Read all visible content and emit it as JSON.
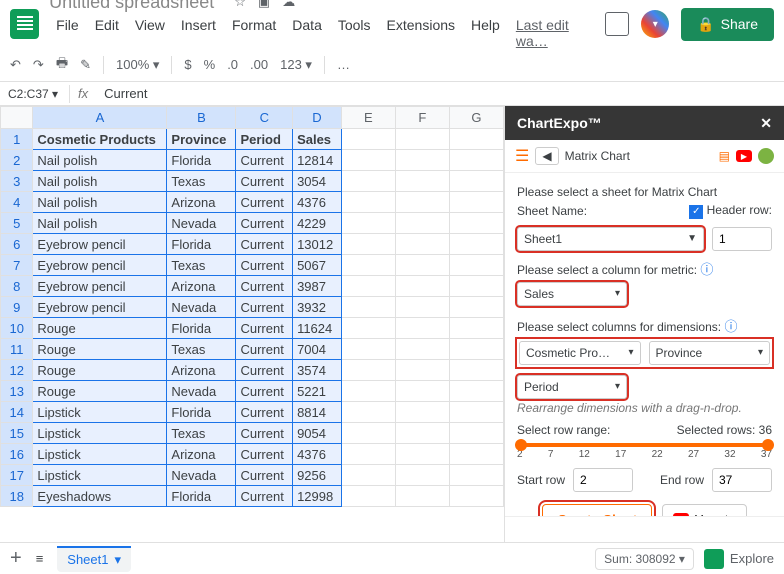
{
  "doc": {
    "title": "Untitled spreadsheet"
  },
  "menu": {
    "file": "File",
    "edit": "Edit",
    "view": "View",
    "insert": "Insert",
    "format": "Format",
    "data": "Data",
    "tools": "Tools",
    "extensions": "Extensions",
    "help": "Help",
    "last_edit": "Last edit wa…"
  },
  "share": "Share",
  "toolbar": {
    "zoom": "100%",
    "currency": "$",
    "percent": "%",
    "dec0": ".0",
    "dec00": ".00",
    "numfmt": "123",
    "font_more": "…"
  },
  "formula": {
    "cell": "C2:C37",
    "value": "Current"
  },
  "columns": [
    "A",
    "B",
    "C",
    "D",
    "E",
    "F",
    "G"
  ],
  "table": {
    "header": [
      "Cosmetic Products",
      "Province",
      "Period",
      "Sales"
    ],
    "rows": [
      [
        "Nail polish",
        "Florida",
        "Current",
        "12814"
      ],
      [
        "Nail polish",
        "Texas",
        "Current",
        "3054"
      ],
      [
        "Nail polish",
        "Arizona",
        "Current",
        "4376"
      ],
      [
        "Nail polish",
        "Nevada",
        "Current",
        "4229"
      ],
      [
        "Eyebrow pencil",
        "Florida",
        "Current",
        "13012"
      ],
      [
        "Eyebrow pencil",
        "Texas",
        "Current",
        "5067"
      ],
      [
        "Eyebrow pencil",
        "Arizona",
        "Current",
        "3987"
      ],
      [
        "Eyebrow pencil",
        "Nevada",
        "Current",
        "3932"
      ],
      [
        "Rouge",
        "Florida",
        "Current",
        "11624"
      ],
      [
        "Rouge",
        "Texas",
        "Current",
        "7004"
      ],
      [
        "Rouge",
        "Arizona",
        "Current",
        "3574"
      ],
      [
        "Rouge",
        "Nevada",
        "Current",
        "5221"
      ],
      [
        "Lipstick",
        "Florida",
        "Current",
        "8814"
      ],
      [
        "Lipstick",
        "Texas",
        "Current",
        "9054"
      ],
      [
        "Lipstick",
        "Arizona",
        "Current",
        "4376"
      ],
      [
        "Lipstick",
        "Nevada",
        "Current",
        "9256"
      ],
      [
        "Eyeshadows",
        "Florida",
        "Current",
        "12998"
      ]
    ]
  },
  "sidebar": {
    "title": "ChartExpo™",
    "chart_name": "Matrix Chart",
    "select_sheet_label": "Please select a sheet for Matrix Chart",
    "sheet_name_label": "Sheet Name:",
    "header_row_label": "Header row:",
    "sheet_name": "Sheet1",
    "header_row_value": "1",
    "metric_label": "Please select a column for metric:",
    "metric": "Sales",
    "dims_label": "Please select columns for dimensions:",
    "dim1": "Cosmetic Pro…",
    "dim2": "Province",
    "dim3": "Period",
    "hint": "Rearrange dimensions with a drag-n-drop.",
    "range_label": "Select row range:",
    "selected_rows": "Selected rows: 36",
    "ticks": [
      "2",
      "7",
      "12",
      "17",
      "22",
      "27",
      "32",
      "37"
    ],
    "start_row_label": "Start row",
    "start_row": "2",
    "end_row_label": "End row",
    "end_row": "37",
    "create": "Create Chart",
    "howto": "How to"
  },
  "tabs": {
    "sheet1": "Sheet1"
  },
  "status": {
    "sum": "Sum: 308092",
    "explore": "Explore"
  }
}
